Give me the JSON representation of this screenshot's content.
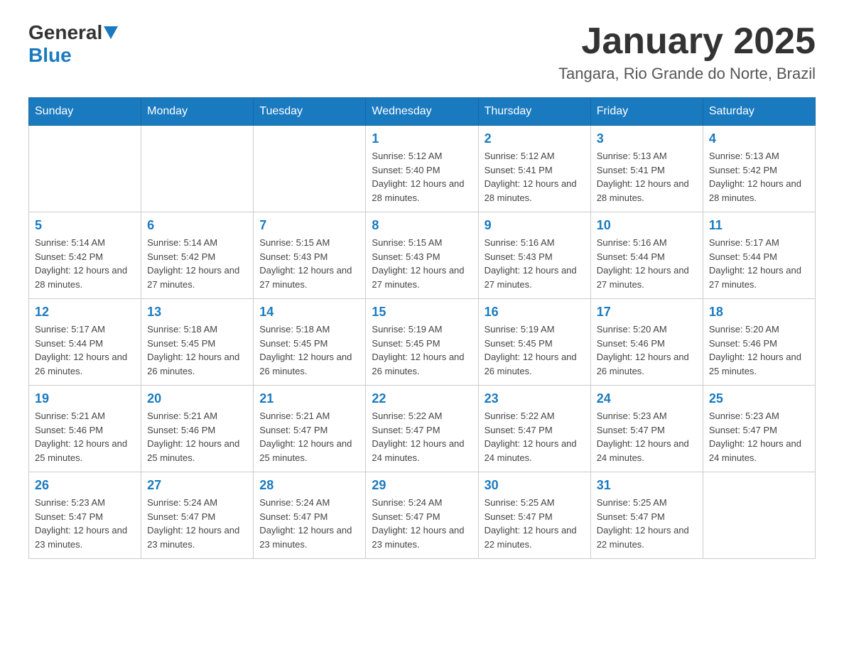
{
  "header": {
    "logo": {
      "general": "General",
      "blue": "Blue"
    },
    "title": "January 2025",
    "location": "Tangara, Rio Grande do Norte, Brazil"
  },
  "weekdays": [
    "Sunday",
    "Monday",
    "Tuesday",
    "Wednesday",
    "Thursday",
    "Friday",
    "Saturday"
  ],
  "weeks": [
    [
      {
        "day": "",
        "info": ""
      },
      {
        "day": "",
        "info": ""
      },
      {
        "day": "",
        "info": ""
      },
      {
        "day": "1",
        "info": "Sunrise: 5:12 AM\nSunset: 5:40 PM\nDaylight: 12 hours and 28 minutes."
      },
      {
        "day": "2",
        "info": "Sunrise: 5:12 AM\nSunset: 5:41 PM\nDaylight: 12 hours and 28 minutes."
      },
      {
        "day": "3",
        "info": "Sunrise: 5:13 AM\nSunset: 5:41 PM\nDaylight: 12 hours and 28 minutes."
      },
      {
        "day": "4",
        "info": "Sunrise: 5:13 AM\nSunset: 5:42 PM\nDaylight: 12 hours and 28 minutes."
      }
    ],
    [
      {
        "day": "5",
        "info": "Sunrise: 5:14 AM\nSunset: 5:42 PM\nDaylight: 12 hours and 28 minutes."
      },
      {
        "day": "6",
        "info": "Sunrise: 5:14 AM\nSunset: 5:42 PM\nDaylight: 12 hours and 27 minutes."
      },
      {
        "day": "7",
        "info": "Sunrise: 5:15 AM\nSunset: 5:43 PM\nDaylight: 12 hours and 27 minutes."
      },
      {
        "day": "8",
        "info": "Sunrise: 5:15 AM\nSunset: 5:43 PM\nDaylight: 12 hours and 27 minutes."
      },
      {
        "day": "9",
        "info": "Sunrise: 5:16 AM\nSunset: 5:43 PM\nDaylight: 12 hours and 27 minutes."
      },
      {
        "day": "10",
        "info": "Sunrise: 5:16 AM\nSunset: 5:44 PM\nDaylight: 12 hours and 27 minutes."
      },
      {
        "day": "11",
        "info": "Sunrise: 5:17 AM\nSunset: 5:44 PM\nDaylight: 12 hours and 27 minutes."
      }
    ],
    [
      {
        "day": "12",
        "info": "Sunrise: 5:17 AM\nSunset: 5:44 PM\nDaylight: 12 hours and 26 minutes."
      },
      {
        "day": "13",
        "info": "Sunrise: 5:18 AM\nSunset: 5:45 PM\nDaylight: 12 hours and 26 minutes."
      },
      {
        "day": "14",
        "info": "Sunrise: 5:18 AM\nSunset: 5:45 PM\nDaylight: 12 hours and 26 minutes."
      },
      {
        "day": "15",
        "info": "Sunrise: 5:19 AM\nSunset: 5:45 PM\nDaylight: 12 hours and 26 minutes."
      },
      {
        "day": "16",
        "info": "Sunrise: 5:19 AM\nSunset: 5:45 PM\nDaylight: 12 hours and 26 minutes."
      },
      {
        "day": "17",
        "info": "Sunrise: 5:20 AM\nSunset: 5:46 PM\nDaylight: 12 hours and 26 minutes."
      },
      {
        "day": "18",
        "info": "Sunrise: 5:20 AM\nSunset: 5:46 PM\nDaylight: 12 hours and 25 minutes."
      }
    ],
    [
      {
        "day": "19",
        "info": "Sunrise: 5:21 AM\nSunset: 5:46 PM\nDaylight: 12 hours and 25 minutes."
      },
      {
        "day": "20",
        "info": "Sunrise: 5:21 AM\nSunset: 5:46 PM\nDaylight: 12 hours and 25 minutes."
      },
      {
        "day": "21",
        "info": "Sunrise: 5:21 AM\nSunset: 5:47 PM\nDaylight: 12 hours and 25 minutes."
      },
      {
        "day": "22",
        "info": "Sunrise: 5:22 AM\nSunset: 5:47 PM\nDaylight: 12 hours and 24 minutes."
      },
      {
        "day": "23",
        "info": "Sunrise: 5:22 AM\nSunset: 5:47 PM\nDaylight: 12 hours and 24 minutes."
      },
      {
        "day": "24",
        "info": "Sunrise: 5:23 AM\nSunset: 5:47 PM\nDaylight: 12 hours and 24 minutes."
      },
      {
        "day": "25",
        "info": "Sunrise: 5:23 AM\nSunset: 5:47 PM\nDaylight: 12 hours and 24 minutes."
      }
    ],
    [
      {
        "day": "26",
        "info": "Sunrise: 5:23 AM\nSunset: 5:47 PM\nDaylight: 12 hours and 23 minutes."
      },
      {
        "day": "27",
        "info": "Sunrise: 5:24 AM\nSunset: 5:47 PM\nDaylight: 12 hours and 23 minutes."
      },
      {
        "day": "28",
        "info": "Sunrise: 5:24 AM\nSunset: 5:47 PM\nDaylight: 12 hours and 23 minutes."
      },
      {
        "day": "29",
        "info": "Sunrise: 5:24 AM\nSunset: 5:47 PM\nDaylight: 12 hours and 23 minutes."
      },
      {
        "day": "30",
        "info": "Sunrise: 5:25 AM\nSunset: 5:47 PM\nDaylight: 12 hours and 22 minutes."
      },
      {
        "day": "31",
        "info": "Sunrise: 5:25 AM\nSunset: 5:47 PM\nDaylight: 12 hours and 22 minutes."
      },
      {
        "day": "",
        "info": ""
      }
    ]
  ]
}
